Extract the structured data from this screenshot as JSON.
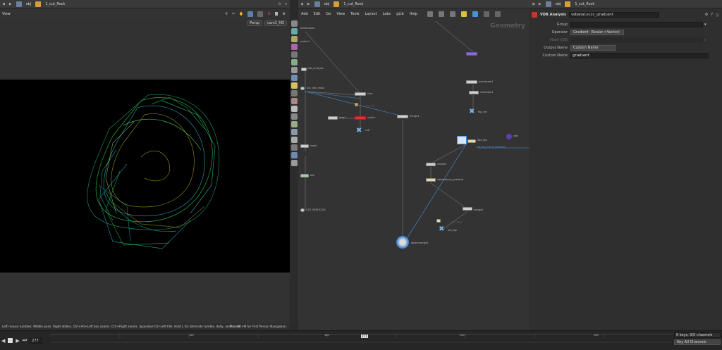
{
  "left_pane": {
    "path_obj": "obj",
    "path_node": "1_cut_flock",
    "view_label": "View",
    "camera_label": "Persp",
    "camera_name": "cam1_HD",
    "status_text": "Left mouse tumbles. Middle pans. Right dollies. Ctrl+Alt+Left box zooms. Ctrl+Right zooms. Spacebar-Ctrl-Left tilts. Hold L for alternate tumble, dolly, and zoom.",
    "status_right": "M or Alt+M for First Person Navigation."
  },
  "network_pane": {
    "path_obj": "obj",
    "path_node": "1_cut_flock",
    "menu": [
      "Add",
      "Edit",
      "Go",
      "View",
      "Tools",
      "Layout",
      "Labs",
      "gLib",
      "Help"
    ],
    "context_label": "Geometry",
    "nodes": [
      {
        "name": "attribnoise1"
      },
      {
        "name": "switch1"
      },
      {
        "name": "vdb_analysis"
      },
      {
        "name": "out_dist_mask"
      },
      {
        "name": "fuse",
        "sub": "add_sub"
      },
      {
        "name": "null",
        "sub": "to_flip"
      },
      {
        "name": "fuse1"
      },
      {
        "name": "switch"
      },
      {
        "name": "merge1"
      },
      {
        "name": "mask"
      },
      {
        "name": "OUT_PARTICLES"
      },
      {
        "name": "bwl"
      },
      {
        "name": "pointmask1"
      },
      {
        "name": "resample1"
      },
      {
        "name": "flip_vel"
      },
      {
        "name": "add_flip"
      },
      {
        "name": "vdb_flip_FIELD_PRIMOFF"
      },
      {
        "name": "smooth"
      },
      {
        "name": "vdbanalysis_gradient"
      },
      {
        "name": "merge1"
      },
      {
        "name": "OUT_TEST"
      },
      {
        "name": "null",
        "sub": "out_flip"
      },
      {
        "name": "objectmerge3"
      },
      {
        "name": "vdb"
      }
    ]
  },
  "params_pane": {
    "path_obj": "obj",
    "path_node": "1_cut_flock",
    "node_type": "VDB Analysis",
    "node_name": "vdbanalysis_gradient",
    "fields": {
      "group_label": "Group",
      "group_value": "",
      "operator_label": "Operator",
      "operator_value": "Gradient",
      "operator_hint": "(Scalar->Vector)",
      "mask_label": "Mask VDB",
      "output_name_label": "Output Name",
      "output_name_value": "Custom Name",
      "custom_name_label": "Custom Name",
      "custom_name_value": "gradient"
    }
  },
  "timeline": {
    "frame": "277",
    "ticks": [
      "120",
      "180",
      "300",
      "360"
    ],
    "current_marker": "277",
    "keys_label": "0 keys, 0/0 channels",
    "key_all_label": "Key All Channels"
  },
  "colors": {
    "pane_bg": "#323232",
    "viewport_bg": "#000000",
    "accent_blue": "#4a90d9",
    "curve_green": "#2ecc40",
    "curve_cyan": "#2ab7ca",
    "curve_yellow": "#d7d42a"
  }
}
